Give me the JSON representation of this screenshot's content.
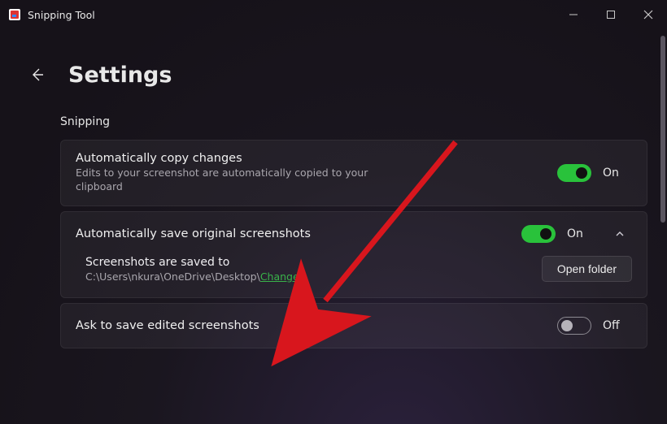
{
  "titlebar": {
    "app_name": "Snipping Tool"
  },
  "header": {
    "title": "Settings"
  },
  "section": {
    "label": "Snipping"
  },
  "settings": {
    "copy": {
      "title": "Automatically copy changes",
      "subtitle": "Edits to your screenshot are automatically copied to your clipboard",
      "state_label": "On"
    },
    "autosave": {
      "title": "Automatically save original screenshots",
      "state_label": "On",
      "sub": {
        "title": "Screenshots are saved to",
        "path": "C:\\Users\\nkura\\OneDrive\\Desktop\\",
        "change": "Change",
        "open_folder": "Open folder"
      }
    },
    "ask_save": {
      "title": "Ask to save edited screenshots",
      "state_label": "Off"
    }
  }
}
